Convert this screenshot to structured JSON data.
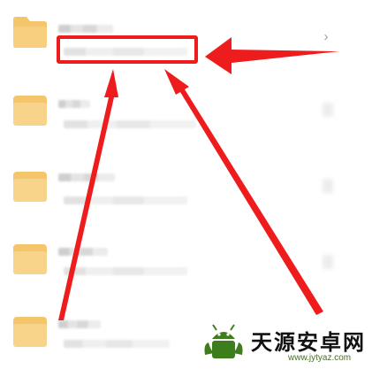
{
  "colors": {
    "folder": "#f5c56b",
    "folder_shade": "#ecb24e",
    "annotation_red": "#ee1c1c",
    "watermark_green": "#3e7d1c"
  },
  "list": {
    "row_count": 5,
    "chevron": "›"
  },
  "watermark": {
    "title": "天源安卓网",
    "url": "www.jytyaz.com",
    "icon": "android-robot-icon"
  }
}
